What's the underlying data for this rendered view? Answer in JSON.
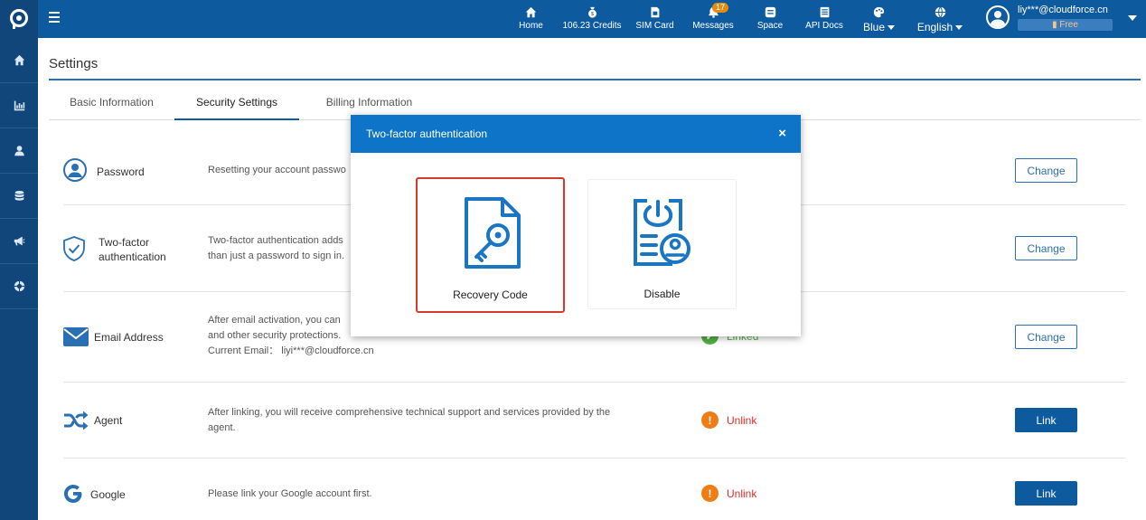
{
  "topbar": {
    "nav": [
      {
        "icon": "home-icon",
        "label": "Home"
      },
      {
        "icon": "credits-icon",
        "label": "106.23 Credits"
      },
      {
        "icon": "sim-card-icon",
        "label": "SIM Card"
      },
      {
        "icon": "messages-icon",
        "label": "Messages",
        "badge": "17"
      },
      {
        "icon": "space-icon",
        "label": "Space"
      },
      {
        "icon": "api-docs-icon",
        "label": "API Docs"
      },
      {
        "icon": "palette-icon",
        "label": "Blue"
      },
      {
        "icon": "globe-icon",
        "label": "English"
      }
    ],
    "user": {
      "email": "liy***@cloudforce.cn",
      "plan": "Free"
    }
  },
  "sidebar": {
    "items": [
      "home-icon",
      "chart-icon",
      "user-icon",
      "database-icon",
      "megaphone-icon",
      "support-icon"
    ]
  },
  "page": {
    "title": "Settings",
    "tabs": [
      "Basic Information",
      "Security Settings",
      "Billing Information"
    ],
    "active_tab": "Security Settings"
  },
  "rows": {
    "password": {
      "title": "Password",
      "desc": "Resetting your account passwo",
      "button": "Change"
    },
    "two_factor": {
      "title_line1": "Two-factor",
      "title_line2": "authentication",
      "desc_line1": "Two-factor authentication adds",
      "desc_line2": "than just a password to sign in.",
      "button": "Change"
    },
    "email": {
      "title": "Email Address",
      "desc_line1": "After email activation, you can",
      "desc_line2": "and other security protections.",
      "desc_line3": "Current Email： liyi***@cloudforce.cn",
      "status": "Linked",
      "button": "Change"
    },
    "agent": {
      "title": "Agent",
      "desc_line1": "After linking, you will receive comprehensive technical support and services provided by the",
      "desc_line2": "agent.",
      "status": "Unlink",
      "button": "Link"
    },
    "google": {
      "title": "Google",
      "desc": "Please link your Google account first.",
      "status": "Unlink",
      "button": "Link"
    }
  },
  "modal": {
    "title": "Two-factor authentication",
    "close": "×",
    "options": [
      {
        "label": "Recovery Code",
        "icon": "recovery-code-icon",
        "selected": true
      },
      {
        "label": "Disable",
        "icon": "disable-icon",
        "selected": false
      }
    ]
  },
  "colors": {
    "topbar": "#0e5a9f",
    "rail": "#10467a",
    "modal_header": "#0e74c7",
    "selected_border": "#d53b2c",
    "linked_green": "#52b043",
    "unlink_red": "#e02e24",
    "warning_orange": "#ee7d16"
  }
}
